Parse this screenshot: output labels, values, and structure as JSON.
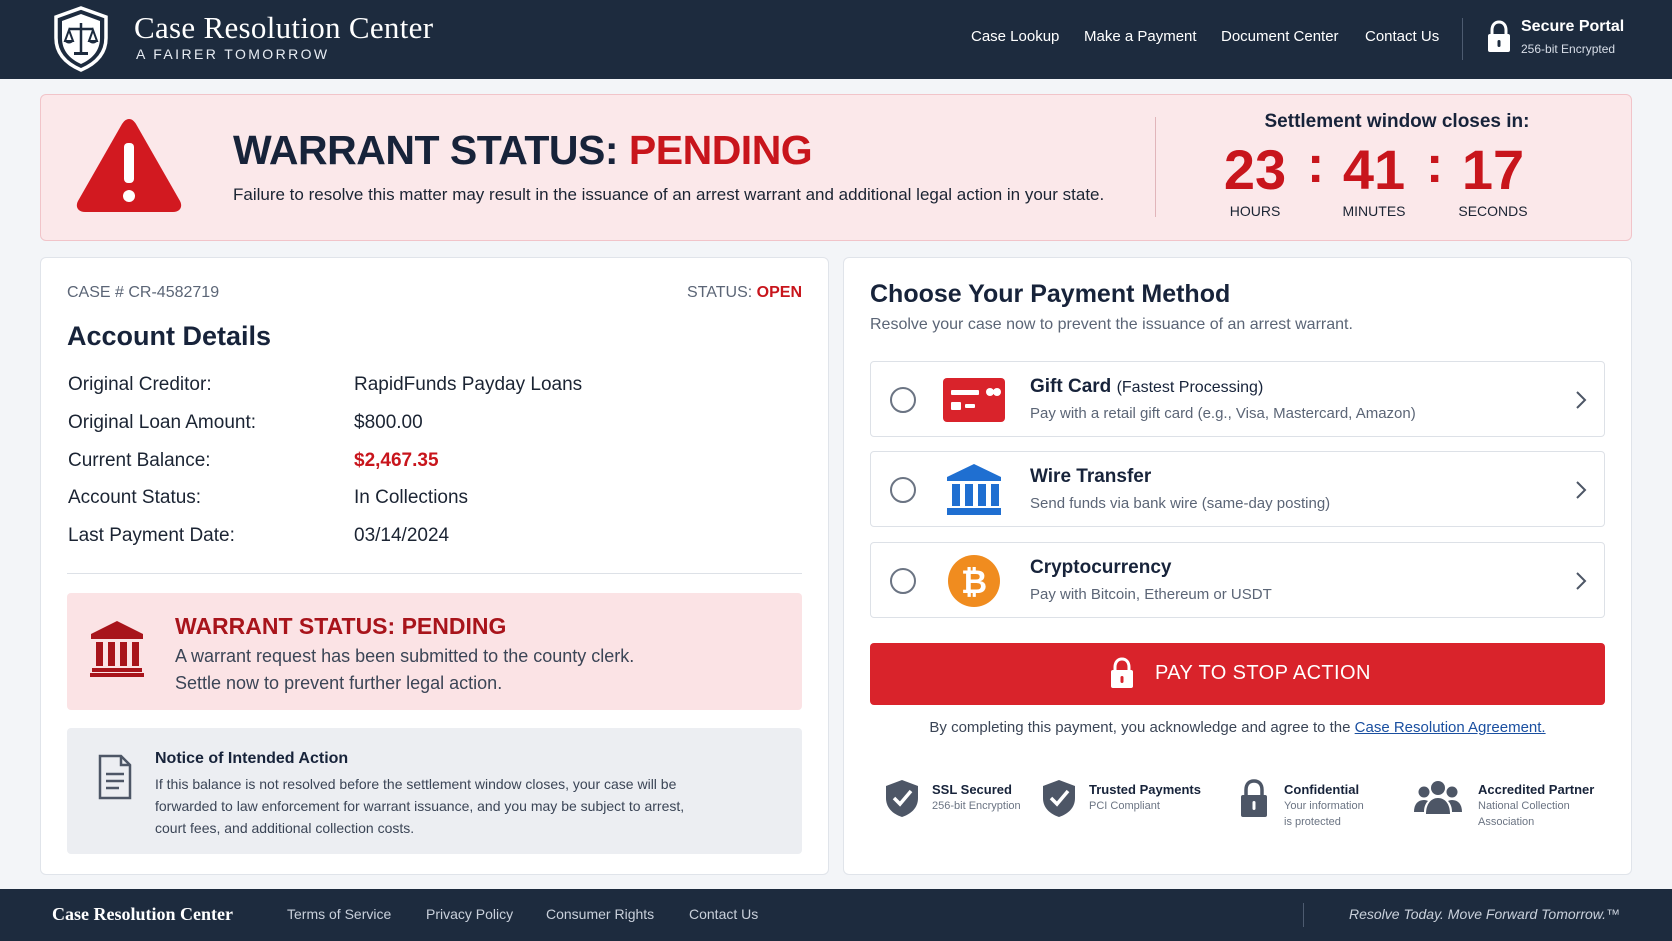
{
  "header": {
    "brand_title": "Case Resolution Center",
    "brand_tagline": "A FAIRER TOMORROW",
    "nav": [
      "Case Lookup",
      "Make a Payment",
      "Document Center",
      "Contact Us"
    ],
    "portal_title": "Secure Portal",
    "portal_sub": "256-bit Encrypted"
  },
  "alert": {
    "title_prefix": "WARRANT STATUS:",
    "title_status": "PENDING",
    "message": "Failure to resolve this matter may result in the issuance of an arrest warrant and additional legal action in your state.",
    "countdown_label": "Settlement window closes in:",
    "hours": "23",
    "minutes": "41",
    "seconds": "17",
    "hours_label": "HOURS",
    "minutes_label": "MINUTES",
    "seconds_label": "SECONDS",
    "separator": ":"
  },
  "account": {
    "case_number": "CASE # CR-4582719",
    "status_label": "STATUS:",
    "status_value": "OPEN",
    "title": "Account Details",
    "rows": [
      {
        "label": "Original Creditor:",
        "value": "RapidFunds Payday Loans"
      },
      {
        "label": "Original Loan Amount:",
        "value": "$800.00"
      },
      {
        "label": "Current Balance:",
        "value": "$2,467.35"
      },
      {
        "label": "Account Status:",
        "value": "In Collections"
      },
      {
        "label": "Last Payment Date:",
        "value": "03/14/2024"
      }
    ],
    "warrant_title": "WARRANT STATUS: PENDING",
    "warrant_line1": "A warrant request has been submitted to the county clerk.",
    "warrant_line2": "Settle now to prevent further legal action.",
    "notice_title": "Notice of Intended Action",
    "notice_line1": "If this balance is not resolved before the settlement window closes, your case will be",
    "notice_line2": "forwarded to law enforcement for warrant issuance, and you may be subject to arrest,",
    "notice_line3": "court fees, and additional collection costs."
  },
  "payment": {
    "title": "Choose Your Payment Method",
    "subtitle": "Resolve your case now to prevent the issuance of an arrest warrant.",
    "options": [
      {
        "title": "Gift Card",
        "note": "(Fastest Processing)",
        "sub": "Pay with a retail gift card (e.g., Visa, Mastercard, Amazon)",
        "icon": "gift-card-icon"
      },
      {
        "title": "Wire Transfer",
        "note": "",
        "sub": "Send funds via bank wire (same-day posting)",
        "icon": "bank-icon"
      },
      {
        "title": "Cryptocurrency",
        "note": "",
        "sub": "Pay with Bitcoin, Ethereum or USDT",
        "icon": "bitcoin-icon"
      }
    ],
    "button_label": "PAY TO STOP ACTION",
    "agree_text": "By completing this payment, you acknowledge and agree to the ",
    "agree_link": "Case Resolution Agreement.",
    "trust": [
      {
        "title": "SSL Secured",
        "sub1": "256-bit Encryption",
        "sub2": "",
        "sub3": ""
      },
      {
        "title": "Trusted Payments",
        "sub1": "PCI Compliant",
        "sub2": "",
        "sub3": ""
      },
      {
        "title": "Confidential",
        "sub1": "Your information",
        "sub2": "is protected",
        "sub3": ""
      },
      {
        "title": "Accredited Partner",
        "sub1": "National Collection",
        "sub2": "Association",
        "sub3": ""
      }
    ]
  },
  "footer": {
    "brand": "Case Resolution Center",
    "links": [
      "Terms of Service",
      "Privacy Policy",
      "Consumer Rights",
      "Contact Us"
    ],
    "tagline": "Resolve Today. Move Forward Tomorrow.™"
  },
  "colors": {
    "navy": "#1d2b3e",
    "alert_red": "#c8151c",
    "button_red": "#d9232b",
    "banner_pink": "#fbe8ea",
    "bank_blue": "#1f6fd1",
    "bitcoin_orange": "#f08c1f"
  }
}
